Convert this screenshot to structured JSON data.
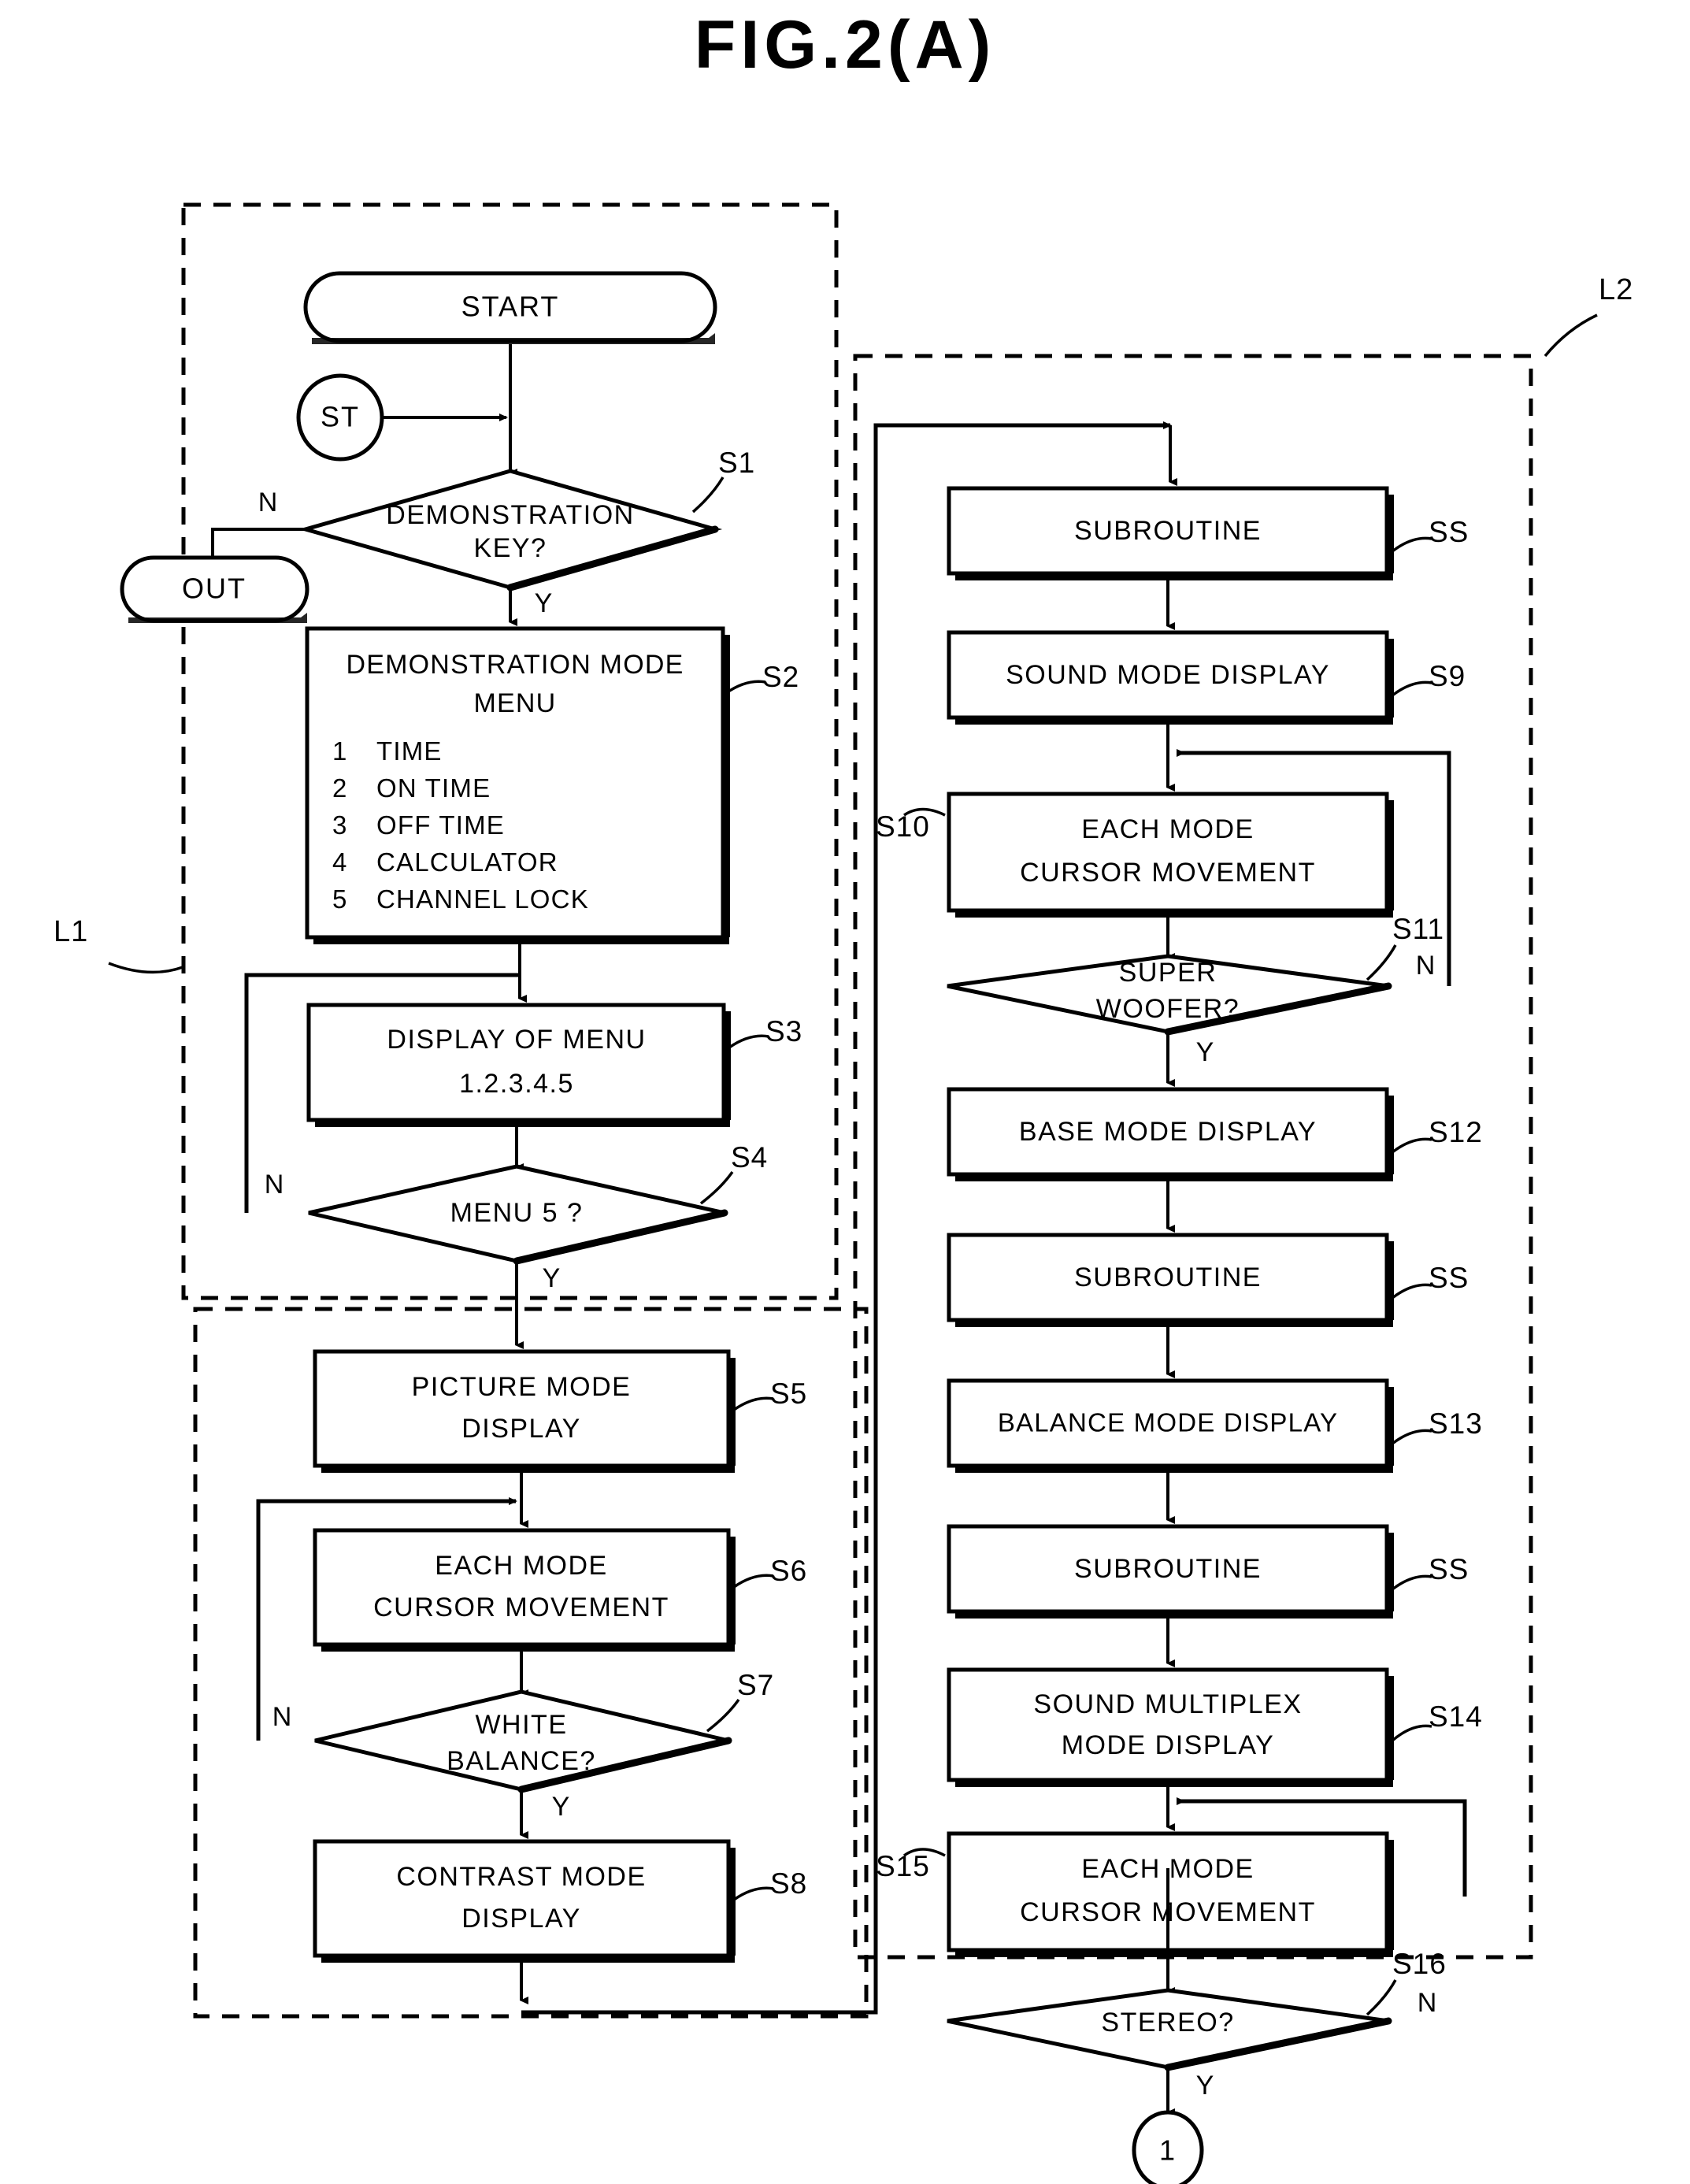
{
  "figure": {
    "title": "FIG.2(A)"
  },
  "groups": [
    {
      "id": "L1",
      "label": "L1"
    },
    {
      "id": "L2",
      "label": "L2"
    }
  ],
  "terminals": {
    "start": "START",
    "out": "OUT",
    "st_connector": "ST",
    "bottom_connector": "1"
  },
  "branch_labels": {
    "yes": "Y",
    "no": "N"
  },
  "left_column": [
    {
      "id": "S1",
      "tag": "S1",
      "shape": "decision",
      "lines": [
        "DEMONSTRATION",
        "KEY?"
      ],
      "no_label": "N",
      "yes_label": "Y"
    },
    {
      "id": "S2",
      "tag": "S2",
      "shape": "process",
      "heading": [
        "DEMONSTRATION MODE",
        "MENU"
      ],
      "menu": [
        {
          "num": "1",
          "text": "TIME"
        },
        {
          "num": "2",
          "text": "ON TIME"
        },
        {
          "num": "3",
          "text": "OFF TIME"
        },
        {
          "num": "4",
          "text": "CALCULATOR"
        },
        {
          "num": "5",
          "text": "CHANNEL LOCK"
        }
      ]
    },
    {
      "id": "S3",
      "tag": "S3",
      "shape": "process",
      "lines": [
        "DISPLAY OF MENU",
        "1.2.3.4.5"
      ]
    },
    {
      "id": "S4",
      "tag": "S4",
      "shape": "decision",
      "lines": [
        "MENU  5 ?"
      ],
      "no_label": "N",
      "yes_label": "Y"
    },
    {
      "id": "S5",
      "tag": "S5",
      "shape": "process",
      "lines": [
        "PICTURE  MODE",
        "DISPLAY"
      ]
    },
    {
      "id": "S6",
      "tag": "S6",
      "shape": "process",
      "lines": [
        "EACH  MODE",
        "CURSOR  MOVEMENT"
      ]
    },
    {
      "id": "S7",
      "tag": "S7",
      "shape": "decision",
      "lines": [
        "WHITE",
        "BALANCE?"
      ],
      "no_label": "N",
      "yes_label": "Y"
    },
    {
      "id": "S8",
      "tag": "S8",
      "shape": "process",
      "lines": [
        "CONTRAST MODE",
        "DISPLAY"
      ]
    }
  ],
  "right_column": [
    {
      "id": "SS1",
      "tag": "SS",
      "shape": "process",
      "lines": [
        "SUBROUTINE"
      ]
    },
    {
      "id": "S9",
      "tag": "S9",
      "shape": "process",
      "lines": [
        "SOUND MODE DISPLAY"
      ]
    },
    {
      "id": "S10",
      "tag": "S10",
      "shape": "process",
      "lines": [
        "EACH MODE",
        "CURSOR  MOVEMENT"
      ]
    },
    {
      "id": "S11",
      "tag": "S11",
      "shape": "decision",
      "lines": [
        "SUPER",
        "WOOFER?"
      ],
      "no_label": "N",
      "yes_label": "Y"
    },
    {
      "id": "S12",
      "tag": "S12",
      "shape": "process",
      "lines": [
        "BASE MODE DISPLAY"
      ]
    },
    {
      "id": "SS2",
      "tag": "SS",
      "shape": "process",
      "lines": [
        "SUBROUTINE"
      ]
    },
    {
      "id": "S13",
      "tag": "S13",
      "shape": "process",
      "lines": [
        "BALANCE  MODE DISPLAY"
      ]
    },
    {
      "id": "SS3",
      "tag": "SS",
      "shape": "process",
      "lines": [
        "SUBROUTINE"
      ]
    },
    {
      "id": "S14",
      "tag": "S14",
      "shape": "process",
      "lines": [
        "SOUND MULTIPLEX",
        "MODE  DISPLAY"
      ]
    },
    {
      "id": "S15",
      "tag": "S15",
      "shape": "process",
      "lines": [
        "EACH MODE",
        "CURSOR  MOVEMENT"
      ]
    },
    {
      "id": "S16",
      "tag": "S16",
      "shape": "decision",
      "lines": [
        "STEREO?"
      ],
      "no_label": "N",
      "yes_label": "Y"
    }
  ]
}
